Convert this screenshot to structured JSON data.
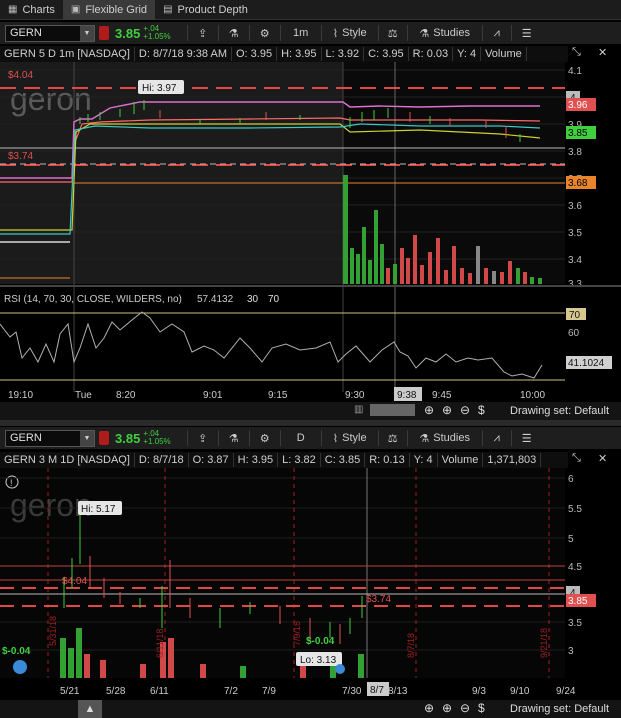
{
  "nav": {
    "tabs": [
      {
        "label": "Charts",
        "icon": "chart-icon"
      },
      {
        "label": "Flexible Grid",
        "icon": "grid-icon",
        "active": true
      },
      {
        "label": "Product Depth",
        "icon": "depth-icon"
      }
    ]
  },
  "colors": {
    "up": "#3fcf3f",
    "down": "#e05050",
    "price_tag": "#e04040",
    "bg": "#000000"
  },
  "top": {
    "symbol": "GERN",
    "last": "3.85",
    "change": "+.04",
    "change_pct": "+1.05%",
    "aggregation": "1m",
    "style_label": "Style",
    "studies_label": "Studies",
    "info": {
      "title": "GERN 5 D 1m [NASDAQ]",
      "date": "D: 8/7/18 9:38 AM",
      "open": "O: 3.95",
      "high": "H: 3.95",
      "low": "L: 3.92",
      "close": "C: 3.95",
      "range": "R: 0.03",
      "ticks": "Y: 4",
      "volume_label": "Volume"
    },
    "watermark": "geron",
    "labels": {
      "hi": "Hi: 3.97",
      "left_high": "$4.04",
      "left_low": "$3.74",
      "tag_396": "3.96",
      "tag_385": "3.85",
      "tag_368": "3.68",
      "tag_4": "4"
    },
    "price_axis": [
      "4.1",
      "4",
      "3.9",
      "3.8",
      "3.7",
      "3.6",
      "3.5",
      "3.4",
      "3.3"
    ],
    "rsi": {
      "label": "RSI (14, 70, 30, CLOSE, WILDERS, no)",
      "value": "57.4132",
      "low": "30",
      "high": "70",
      "axis_70": "70",
      "axis_60": "60",
      "current": "41.1024"
    },
    "time_axis": [
      "19:10",
      "Tue",
      "8:20",
      "9:01",
      "9:15",
      "9:30",
      "9:45",
      "10:00"
    ],
    "crosshair_time": "9:38",
    "drawing_set": "Drawing set: Default"
  },
  "bottom": {
    "symbol": "GERN",
    "last": "3.85",
    "change": "+.04",
    "change_pct": "+1.05%",
    "aggregation": "D",
    "style_label": "Style",
    "studies_label": "Studies",
    "info": {
      "title": "GERN 3 M 1D [NASDAQ]",
      "date": "D: 8/7/18",
      "open": "O: 3.87",
      "high": "H: 3.95",
      "low": "L: 3.82",
      "close": "C: 3.85",
      "range": "R: 0.13",
      "ticks": "Y: 4",
      "volume_label": "Volume",
      "volume_value": "1,371,803"
    },
    "watermark": "geron",
    "labels": {
      "hi": "Hi: 5.17",
      "lo": "Lo: 3.13",
      "left_price": "$4.04",
      "cross_price": "$3.74",
      "div_left": "$-0.04",
      "div_mid": "$-0.04",
      "tag_385": "3.85",
      "tag_4": "4",
      "event_531": "5/31/18",
      "event_611": "6/11/18",
      "event_79": "7/9/18",
      "event_87": "8/7/18",
      "event_921": "9/21/18"
    },
    "price_axis": [
      "6",
      "5.5",
      "5",
      "4.5",
      "4",
      "3.5",
      "3"
    ],
    "time_axis": [
      "5/21",
      "5/28",
      "6/11",
      "7/2",
      "7/9",
      "7/30",
      "8/13",
      "9/3",
      "9/10",
      "9/24"
    ],
    "crosshair_date": "8/7",
    "drawing_set": "Drawing set: Default"
  }
}
